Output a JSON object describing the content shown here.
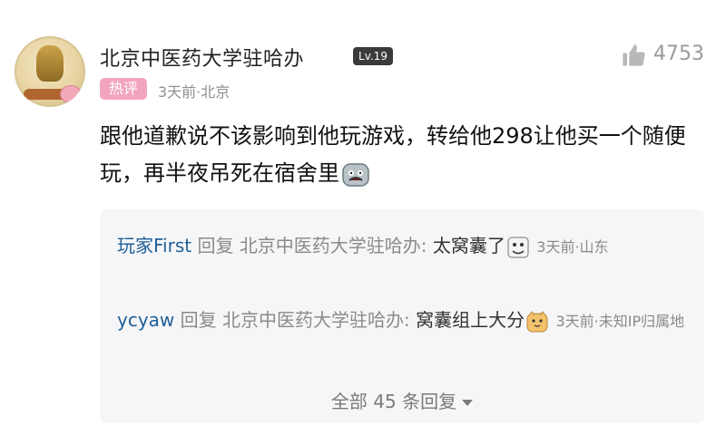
{
  "comment": {
    "username": "北京中医药大学驻哈办",
    "level": "Lv.19",
    "badge": "热评",
    "meta": "3天前·北京",
    "likes": "4753",
    "text": "跟他道歉说不该影响到他玩游戏，转给他298让他买一个随便玩，再半夜吊死在宿舍里",
    "emoji": "ghost-emoji"
  },
  "replies": [
    {
      "user": "玩家First",
      "action": "回复",
      "target": "北京中医药大学驻哈办:",
      "text": "太窝囊了",
      "emoji": "face-emoji",
      "time": "3天前·山东"
    },
    {
      "user": "ycyaw",
      "action": "回复",
      "target": "北京中医药大学驻哈办:",
      "text": "窝囊组上大分",
      "emoji": "dog-emoji",
      "time": "3天前·未知IP归属地"
    }
  ],
  "view_all": {
    "label": "全部 45 条回复"
  },
  "colors": {
    "badge_pink": "#f2a6bd",
    "reply_user_blue": "#1f5f98",
    "level_bg": "#3a3a3a",
    "reply_box_bg": "#f6f6f8"
  }
}
